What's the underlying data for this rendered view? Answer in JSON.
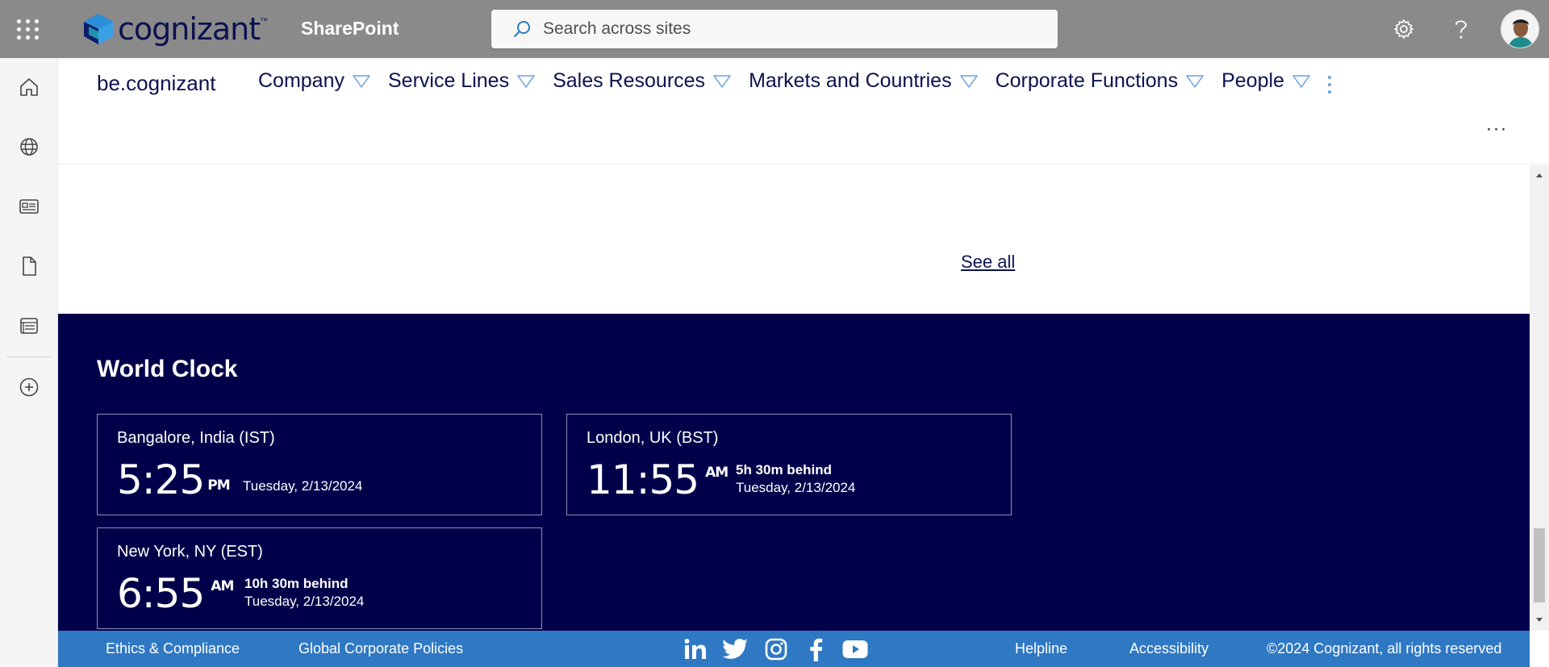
{
  "suitebar": {
    "brand": "cognizant",
    "brand_tm": "™",
    "app_name": "SharePoint",
    "search_placeholder": "Search across sites"
  },
  "site": {
    "title": "be.cognizant",
    "nav": [
      {
        "label": "Company"
      },
      {
        "label": "Service Lines"
      },
      {
        "label": "Sales Resources"
      },
      {
        "label": "Markets and Countries"
      },
      {
        "label": "Corporate Functions"
      },
      {
        "label": "People"
      }
    ],
    "overflow_glyph": "···"
  },
  "content": {
    "see_all": "See all"
  },
  "world_clock": {
    "title": "World Clock",
    "clocks": [
      {
        "city": "Bangalore, India (IST)",
        "time": "5:25",
        "ampm": "PM",
        "behind": "",
        "date": "Tuesday, 2/13/2024"
      },
      {
        "city": "London, UK (BST)",
        "time": "11:55",
        "ampm": "AM",
        "behind": "5h 30m behind",
        "date": "Tuesday, 2/13/2024"
      },
      {
        "city": "New York, NY (EST)",
        "time": "6:55",
        "ampm": "AM",
        "behind": "10h 30m behind",
        "date": "Tuesday, 2/13/2024"
      }
    ]
  },
  "footer": {
    "ethics": "Ethics & Compliance",
    "policies": "Global Corporate Policies",
    "social_icons": [
      "linkedin-icon",
      "twitter-icon",
      "instagram-icon",
      "facebook-icon",
      "youtube-icon"
    ],
    "helpline": "Helpline",
    "accessibility": "Accessibility",
    "copyright": "©2024 Cognizant, all rights reserved"
  },
  "colors": {
    "suitebar_bg": "#8a8a8a",
    "brand_navy": "#0b1250",
    "world_clock_bg": "#00004a",
    "footer_bg": "#2f78c4",
    "nav_chevron": "#6a9fdc"
  }
}
